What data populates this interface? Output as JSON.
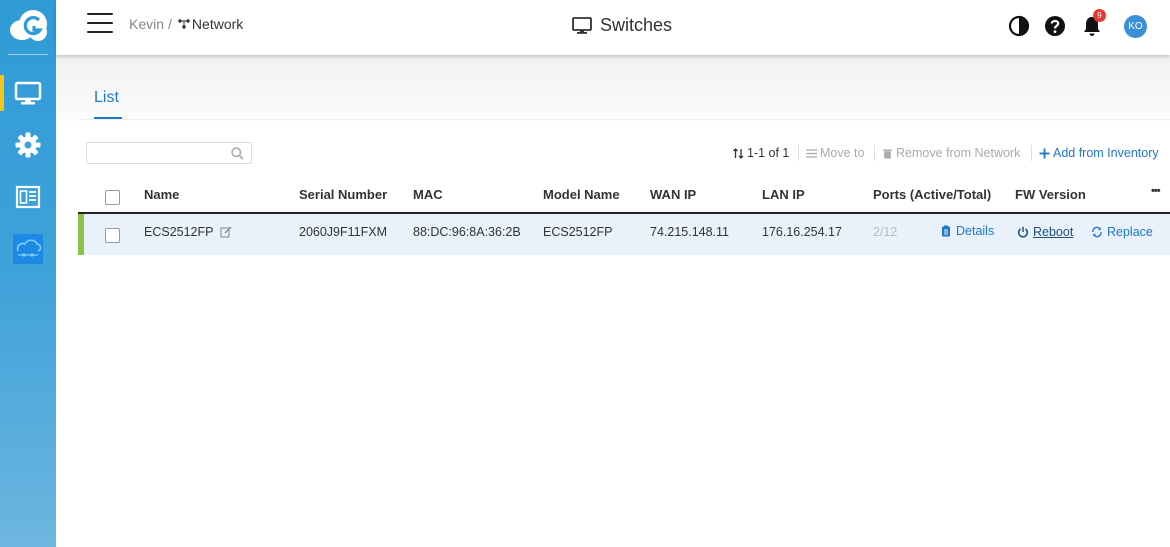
{
  "header": {
    "breadcrumb_org": "Kevin",
    "breadcrumb_sep": "/",
    "breadcrumb_network": "Network",
    "title": "Switches",
    "notification_count": "9",
    "avatar_initials": "KO"
  },
  "sidebar": {
    "items": [
      {
        "icon": "monitor-icon",
        "active": true
      },
      {
        "icon": "gear-icon",
        "active": false
      },
      {
        "icon": "report-icon",
        "active": false
      },
      {
        "icon": "cloud-network-icon",
        "active": false
      }
    ]
  },
  "tabs": [
    {
      "label": "List",
      "active": true
    }
  ],
  "search": {
    "placeholder": "",
    "value": ""
  },
  "toolbar": {
    "count": "1-1 of 1",
    "move_to": "Move to",
    "remove": "Remove from Network",
    "add": "Add from Inventory"
  },
  "table": {
    "columns": [
      "Name",
      "Serial Number",
      "MAC",
      "Model Name",
      "WAN IP",
      "LAN IP",
      "Ports (Active/Total)",
      "FW Version"
    ],
    "more": "•••",
    "rows": [
      {
        "name": "ECS2512FP",
        "serial": "2060J9F11FXM",
        "mac": "88:DC:96:8A:36:2B",
        "model": "ECS2512FP",
        "wan_ip": "74.215.148.11",
        "lan_ip": "176.16.254.17",
        "ports": "2/12",
        "details": "Details",
        "reboot": "Reboot",
        "replace": "Replace",
        "status_color": "#8bc34a"
      }
    ]
  },
  "colors": {
    "accent": "#1f78c8",
    "sidebar": "#3fa2da",
    "active_indicator": "#f5c518"
  }
}
